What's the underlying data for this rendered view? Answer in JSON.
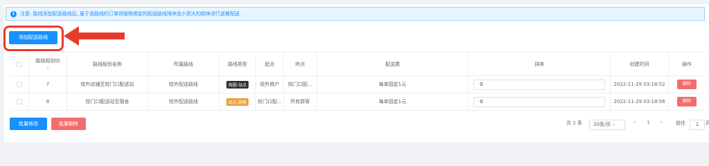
{
  "notice": {
    "icon": "info-icon",
    "text": "注意: 路线添加配送路线后, 属于该路线的订单将按照绑定的配送路线排序由小到大的顺序进行送餐配送."
  },
  "toolbar": {
    "add_label": "添加配送路线"
  },
  "table": {
    "headers": {
      "id": "路线规划ID",
      "name": "路线规划名称",
      "route": "所属路线",
      "type": "路线类型",
      "start": "起点",
      "end": "终点",
      "fee": "配送费",
      "sort": "排序",
      "created": "创建时间",
      "action": "操作"
    },
    "rows": [
      {
        "id": "7",
        "name": "校外店铺至校门口配送站",
        "route": "校外配送路线",
        "type": "商圈-站点",
        "type_style": "dark",
        "start": "校外商户",
        "end": "校门口配...",
        "fee": "每单固定1元",
        "sort": "0",
        "created": "2022-11-29 03:18:52",
        "action": "删除"
      },
      {
        "id": "8",
        "name": "校门口配送站至宿舍",
        "route": "校外配送路线",
        "type": "站点-顾客",
        "type_style": "warn",
        "start": "校门口配...",
        "end": "所有顾客",
        "fee": "每单固定1元",
        "sort": "0",
        "created": "2022-11-29 03:18:56",
        "action": "删除"
      }
    ]
  },
  "footer": {
    "batch_edit": "批量修改",
    "batch_delete": "批量删除",
    "total": "共 2 条",
    "page_size": "20条/页",
    "prev": "<",
    "page": "1",
    "next": ">",
    "goto_label": "前往",
    "goto_value": "1",
    "goto_suffix": "页"
  },
  "colors": {
    "primary": "#1890ff",
    "danger": "#f56c6c",
    "highlight": "#e83a2a"
  }
}
